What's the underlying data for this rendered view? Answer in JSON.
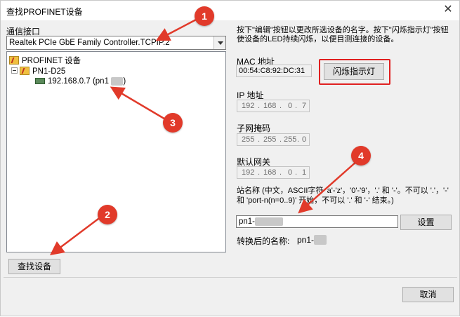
{
  "window": {
    "title": "查找PROFINET设备",
    "close": "✕"
  },
  "interface": {
    "label": "通信接口",
    "selected": "Realtek PCIe GbE Family Controller.TCPIP.2"
  },
  "tree": {
    "root": "PROFINET 设备",
    "node": "PN1-D25",
    "device_ip": "192.168.0.7 (pn1",
    "device_suffix": ")"
  },
  "right": {
    "instruction": "按下\"编辑\"按钮以更改所选设备的名字。按下\"闪烁指示灯\"按钮使设备的LED持续闪烁，以便目测连接的设备。",
    "mac_label": "MAC 地址",
    "mac_value": "00:54:C8:92:DC:31",
    "flash_button": "闪烁指示灯",
    "ip_label": "IP 地址",
    "ip": [
      "192",
      "168",
      "0",
      "7"
    ],
    "mask_label": "子网掩码",
    "mask": [
      "255",
      "255",
      "255",
      "0"
    ],
    "gateway_label": "默认网关",
    "gateway": [
      "192",
      "168",
      "0",
      "1"
    ],
    "station_label_1": "站名称 (中文，ASCII字符 'a'-'z'，'0'-'9'，'.' 和 '-'。不可以 '.'，'-'",
    "station_label_2": "和 'port-n(n=0..9)' 开始，不可以 '.' 和 '-' 结束。)",
    "station_value": "pn1-",
    "set_button": "设置",
    "converted_label": "转换后的名称:",
    "converted_value": "pn1-"
  },
  "buttons": {
    "search": "查找设备",
    "cancel": "取消"
  },
  "annotations": [
    "1",
    "2",
    "3",
    "4"
  ],
  "colors": {
    "annotation": "#e13a2a"
  }
}
